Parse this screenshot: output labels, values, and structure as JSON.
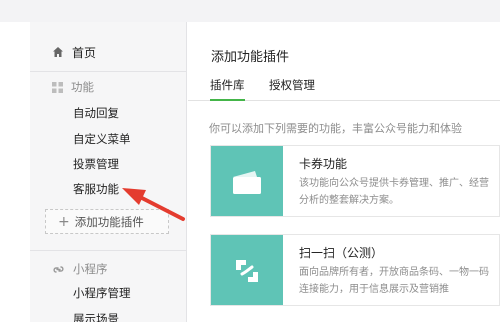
{
  "sidebar": {
    "home_label": "首页",
    "features_group": "功能",
    "feature_items": [
      "自动回复",
      "自定义菜单",
      "投票管理",
      "客服功能"
    ],
    "add_plugin_label": "添加功能插件",
    "miniprogram_group": "小程序",
    "miniprogram_items": [
      "小程序管理",
      "展示场景"
    ]
  },
  "main": {
    "title": "添加功能插件",
    "tabs": [
      "插件库",
      "授权管理"
    ],
    "active_tab": 0,
    "description": "你可以添加下列需要的功能，丰富公众号能力和体验",
    "plugins": [
      {
        "name": "卡券功能",
        "icon": "card-wallet-icon",
        "description": "该功能向公众号提供卡券管理、推广、经营分析的整套解决方案。"
      },
      {
        "name": "扫一扫（公测）",
        "icon": "scan-icon",
        "description": "面向品牌所有者，开放商品条码、一物一码连接能力，用于信息展示及营销推"
      }
    ]
  },
  "colors": {
    "accent_green": "#44b549",
    "plugin_icon_bg": "#5fc4b6",
    "annotation_arrow": "#e43c2f"
  }
}
